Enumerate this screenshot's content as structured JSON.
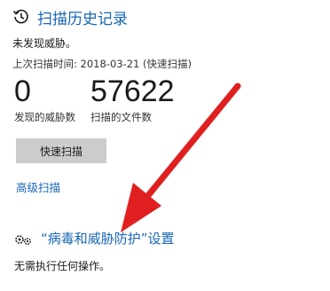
{
  "history": {
    "icon": "history-icon",
    "title": "扫描历史记录"
  },
  "status": {
    "text": "未发现威胁。"
  },
  "last_scan": {
    "text": "上次扫描时间: 2018-03-21 (快速扫描)"
  },
  "stats": {
    "threats_count": "0",
    "threats_label": "发现的威胁数",
    "files_count": "57622",
    "files_label": "扫描的文件数"
  },
  "actions": {
    "quick_scan_label": "快速扫描",
    "advanced_scan_label": "高级扫描"
  },
  "settings": {
    "icon": "gears-icon",
    "title": "“病毒和威胁防护”设置",
    "note": "无需执行任何操作。"
  },
  "annotation": {
    "arrow_color": "#e02020"
  },
  "colors": {
    "link": "#1866b5",
    "button": "#cccccc"
  }
}
